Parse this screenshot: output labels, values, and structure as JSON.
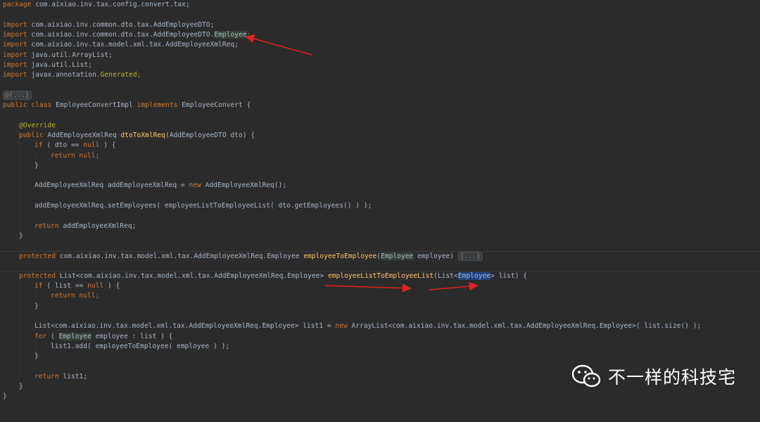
{
  "editor": {
    "lines": [
      {
        "k": "package",
        "t": " com.aixiao.inv.tax.config.convert.tax;"
      },
      {
        "k": "import",
        "t": " com.aixiao.inv.common.dto.tax.AddEmployeeDTO;"
      },
      {
        "k": "import",
        "t": " com.aixiao.inv.common.dto.tax.AddEmployeeDTO.",
        "h": "Employee",
        "e": ";"
      },
      {
        "k": "import",
        "t": " com.aixiao.inv.tax.model.xml.tax.AddEmployeeXmlReq;"
      },
      {
        "k": "import",
        "t": " java.util.ArrayList;"
      },
      {
        "k": "import",
        "t": " java.util.List;"
      },
      {
        "k": "import",
        "t": " javax.annotation.",
        "g": "Generated",
        "e": ";"
      },
      {
        "fold": "@{...}"
      },
      {
        "k": "public",
        "k2": " class",
        "t": " EmployeeConvertImpl ",
        "k3": "implements",
        "t2": " EmployeeConvert {"
      },
      {
        "ann": "@Override"
      },
      {
        "k": "public",
        "t": " AddEmployeeXmlReq ",
        "f": "dtoToXmlReq",
        "t2": "(AddEmployeeDTO dto) {"
      },
      {
        "k": "if",
        "t": " ( dto == ",
        "k2": "null",
        "t2": " ) {"
      },
      {
        "k": "return",
        "k2": " null",
        "t": ";"
      },
      {
        "t": "}"
      },
      {
        "t": "AddEmployeeXmlReq addEmployeeXmlReq = ",
        "k": "new",
        "t2": " AddEmployeeXmlReq();"
      },
      {
        "t": "addEmployeeXmlReq.setEmployees( employeeListToEmployeeList( dto.getEmployees() ) );"
      },
      {
        "k": "return",
        "t": " addEmployeeXmlReq;"
      },
      {
        "t": "}"
      },
      {
        "k": "protected",
        "t": " com.aixiao.inv.tax.model.xml.tax.AddEmployeeXmlReq.Employee ",
        "f": "employeeToEmployee",
        "t2": "(",
        "h": "Employee",
        "t3": " employee) ",
        "fold": "{...}"
      },
      {
        "k": "protected",
        "t": " List<com.aixiao.inv.tax.model.xml.tax.AddEmployeeXmlReq.Employee> ",
        "f": "employeeListToEmployeeList",
        "t2": "(List<",
        "s": "Employee",
        "t3": "> list) {"
      },
      {
        "k": "if",
        "t": " ( list == ",
        "k2": "null",
        "t2": " ) {"
      },
      {
        "k": "return",
        "k2": " null",
        "t": ";"
      },
      {
        "t": "}"
      },
      {
        "t": "List<com.aixiao.inv.tax.model.xml.tax.AddEmployeeXmlReq.Employee> list1 = ",
        "k": "new",
        "t2": " ArrayList<com.aixiao.inv.tax.model.xml.tax.AddEmployeeXmlReq.Employee>( list.size() );"
      },
      {
        "k": "for",
        "t": " ( ",
        "h": "Employee",
        "t2": " employee : list ) {"
      },
      {
        "t": "list1.add( employeeToEmployee( employee ) );"
      },
      {
        "t": "}"
      },
      {
        "k": "return",
        "t": " list1;"
      },
      {
        "t": "}"
      },
      {
        "t": "}"
      }
    ]
  },
  "watermark": {
    "text": "不一样的科技宅",
    "icon": "wechat-icon"
  },
  "colors": {
    "background": "#2b2b2b",
    "keyword": "#cc7832",
    "annotation": "#bbb529",
    "function": "#ffc66d",
    "default": "#a9b7c6",
    "arrow": "#e02020"
  }
}
